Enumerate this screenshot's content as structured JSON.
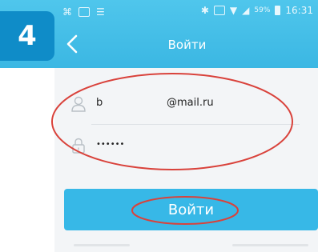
{
  "step_badge": "4",
  "statusbar": {
    "time": "16:31",
    "signal": "59%"
  },
  "appbar": {
    "title": "Войти",
    "back_icon": "chevron-left-icon"
  },
  "form": {
    "email": {
      "prefix": "b",
      "domain": "@mail.ru",
      "icon": "user-icon"
    },
    "password": {
      "value": "••••••",
      "icon": "lock-icon"
    }
  },
  "login_button": {
    "label": "Войти"
  },
  "colors": {
    "appbar": "#3bb7e3",
    "badge": "#0f8cc8",
    "button": "#37b8e7",
    "annotation": "#d9423b"
  }
}
